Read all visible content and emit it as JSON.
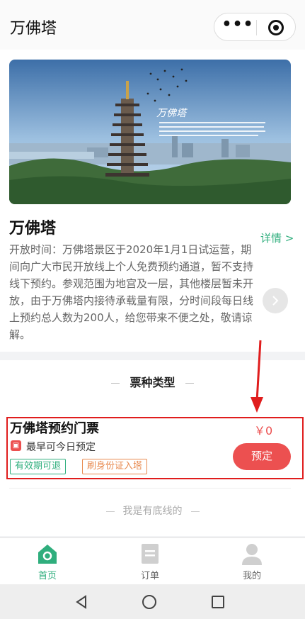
{
  "header": {
    "title": "万佛塔",
    "menu_icon": "more-dots-icon",
    "close_icon": "target-circle-icon"
  },
  "scenic": {
    "name": "万佛塔",
    "details_link": "详情 >",
    "description": "开放时间：万佛塔景区于2020年1月1日试运营，期间向广大市民开放线上个人免费预约通道，暂不支持线下预约。参观范围为地宫及一层，其他楼层暂未开放，由于万佛塔内接待承载量有限，分时间段每日线上预约总人数为200人，给您带来不便之处，敬请谅解。",
    "banner_calligraphy": "万佛塔"
  },
  "tickets": {
    "section_title": "票种类型",
    "items": [
      {
        "name": "万佛塔预约门票",
        "price": "￥0",
        "earliest": "最早可今日预定",
        "tags": [
          "有效期可退",
          "刷身份证入塔"
        ],
        "book_label": "预定"
      }
    ],
    "footer_note": "我是有底线的"
  },
  "tabbar": {
    "items": [
      {
        "label": "首页",
        "icon": "home-icon",
        "active": true
      },
      {
        "label": "订单",
        "icon": "order-icon",
        "active": false
      },
      {
        "label": "我的",
        "icon": "user-icon",
        "active": false
      }
    ]
  },
  "colors": {
    "accent": "#2fae7d",
    "price": "#ec5050",
    "tag_orange": "#e88a4f",
    "annotation": "#e01d1d"
  }
}
